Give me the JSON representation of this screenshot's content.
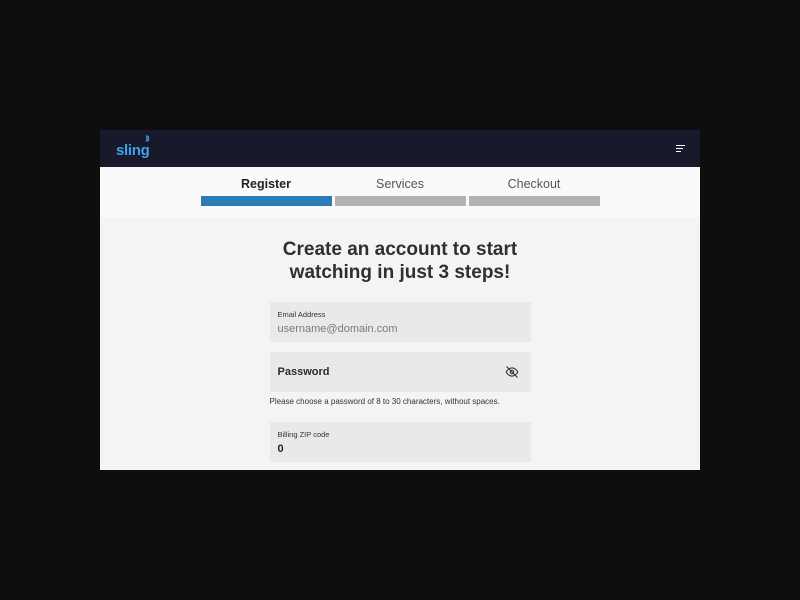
{
  "header": {
    "logo_text": "sling",
    "menu_icon": "hamburger-menu-icon"
  },
  "steps": [
    {
      "label": "Register",
      "active": true
    },
    {
      "label": "Services",
      "active": false
    },
    {
      "label": "Checkout",
      "active": false
    }
  ],
  "colors": {
    "topbar": "#181a2b",
    "logo": "#3aa3e8",
    "active_step": "#2b7cb6",
    "inactive_step": "#b2b2b2"
  },
  "main": {
    "headline": "Create an account to start watching in just 3 steps!",
    "email": {
      "label": "Email Address",
      "placeholder": "username@domain.com",
      "value": ""
    },
    "password": {
      "label": "Password",
      "toggle_icon": "eye-off-icon",
      "hint": "Please choose a password of 8 to 30 characters, without spaces."
    },
    "zip": {
      "label": "Billing ZIP code",
      "value": "0"
    }
  }
}
